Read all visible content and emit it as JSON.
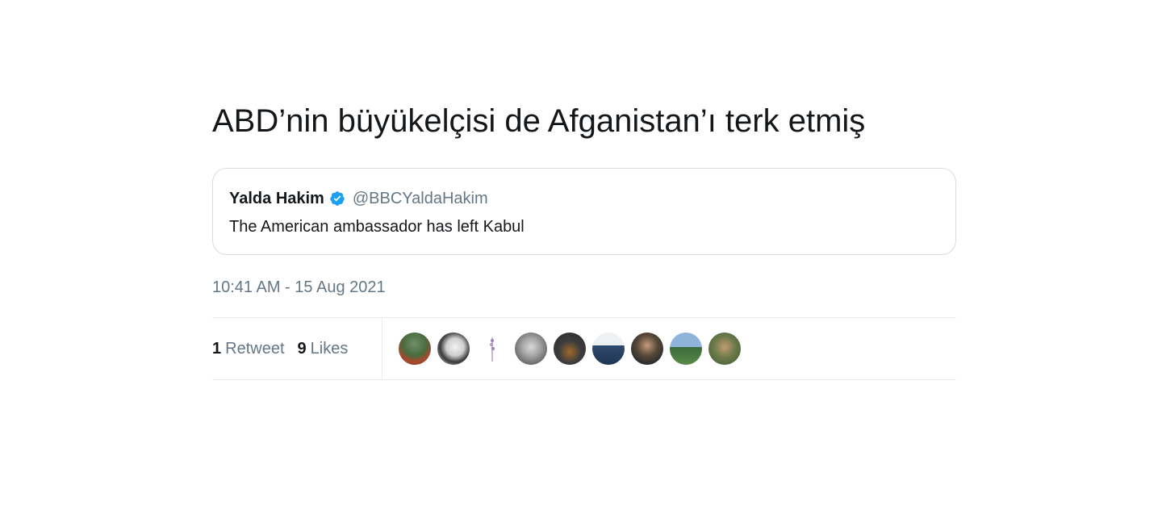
{
  "tweet": {
    "text": "ABD’nin büyükelçisi de Afganistan’ı terk etmiş",
    "timestamp": "10:41 AM - 15 Aug 2021"
  },
  "quoted_tweet": {
    "name": "Yalda Hakim",
    "handle": "@BBCYaldaHakim",
    "verified": true,
    "text": "The American ambassador has left Kabul"
  },
  "stats": {
    "retweets_count": "1",
    "retweets_label": "Retweet",
    "likes_count": "9",
    "likes_label": "Likes"
  },
  "likers": [
    {
      "avatar": "avatar-1"
    },
    {
      "avatar": "avatar-2"
    },
    {
      "avatar": "avatar-3"
    },
    {
      "avatar": "avatar-4"
    },
    {
      "avatar": "avatar-5"
    },
    {
      "avatar": "avatar-6"
    },
    {
      "avatar": "avatar-7"
    },
    {
      "avatar": "avatar-8"
    },
    {
      "avatar": "avatar-9"
    }
  ],
  "colors": {
    "text_primary": "#14171a",
    "text_secondary": "#657786",
    "verified_blue": "#1da1f2",
    "border": "#e6ecf0"
  }
}
